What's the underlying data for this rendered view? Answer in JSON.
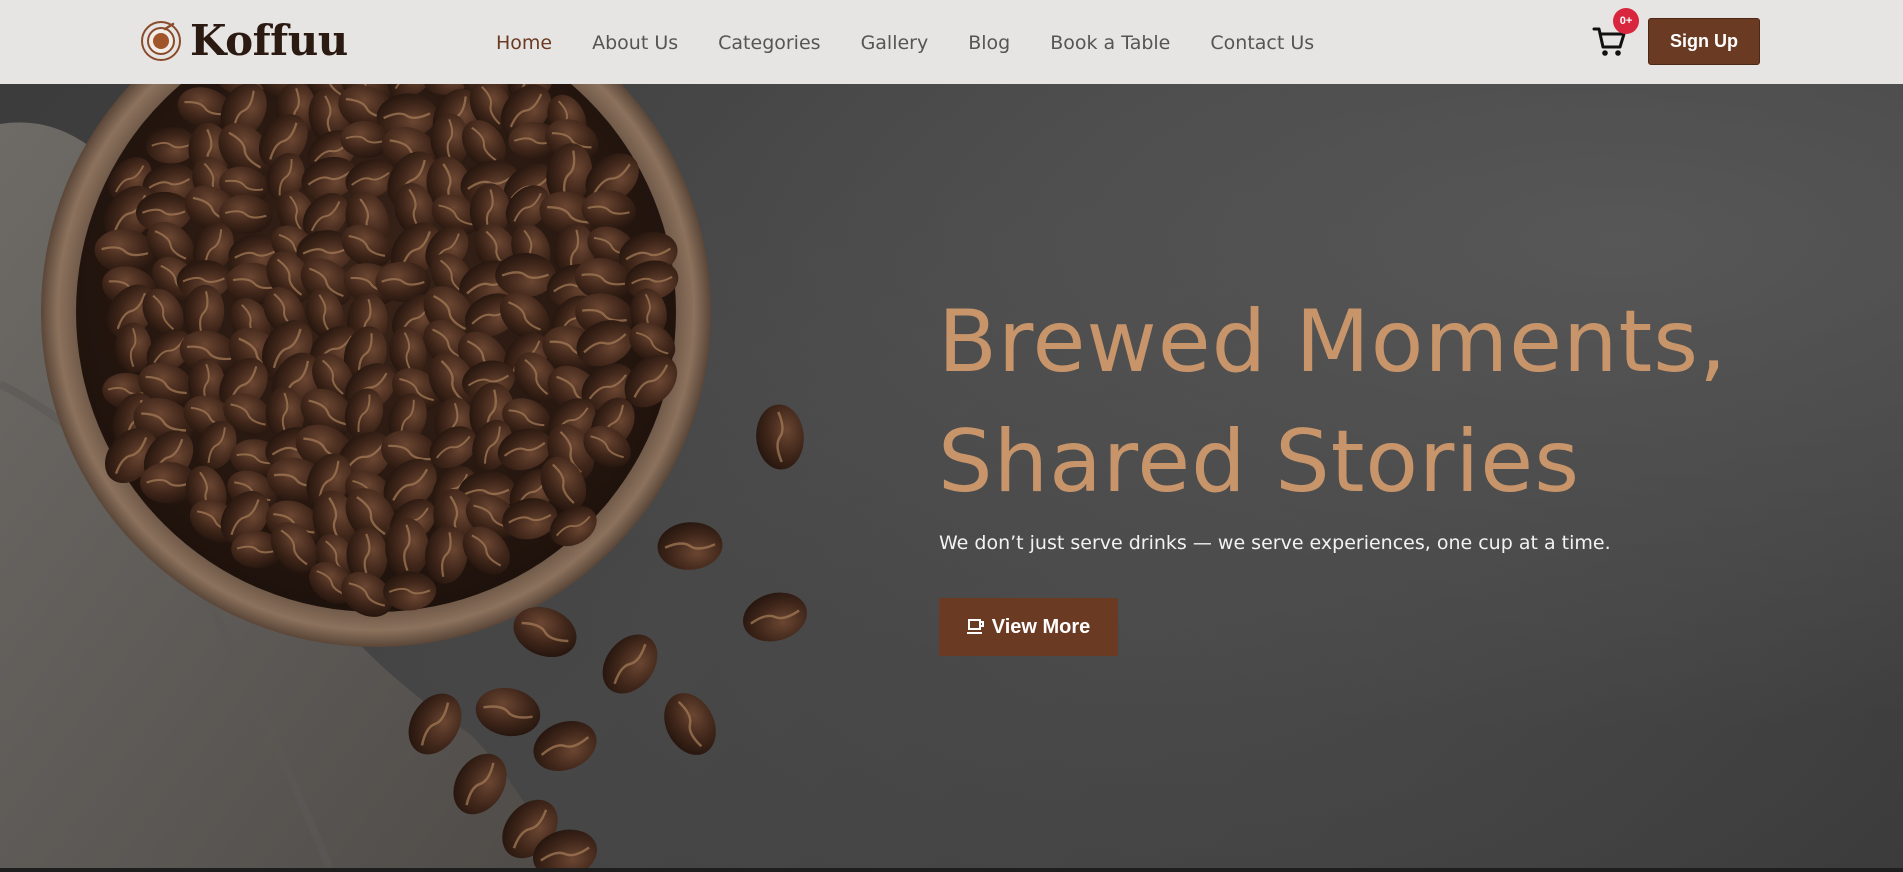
{
  "brand": {
    "name": "Koffuu",
    "logo_icon": "coffee-cup-logo-icon"
  },
  "nav": {
    "items": [
      {
        "label": "Home",
        "active": true
      },
      {
        "label": "About Us",
        "active": false
      },
      {
        "label": "Categories",
        "active": false
      },
      {
        "label": "Gallery",
        "active": false
      },
      {
        "label": "Blog",
        "active": false
      },
      {
        "label": "Book a Table",
        "active": false
      },
      {
        "label": "Contact Us",
        "active": false
      }
    ]
  },
  "cart": {
    "icon": "cart-icon",
    "badge": "0+"
  },
  "header": {
    "signup_label": "Sign Up"
  },
  "hero": {
    "title_line1": "Brewed Moments,",
    "title_line2": "Shared Stories",
    "subtitle": "We don’t just serve drinks — we serve experiences, one cup at a time.",
    "button_label": "View More",
    "button_icon": "coffee-cup-icon",
    "image": "coffee-beans-bowl"
  },
  "colors": {
    "accent": "#6b3a23",
    "title": "#c8956b",
    "header_bg": "#e6e5e3",
    "badge": "#d9263f"
  }
}
